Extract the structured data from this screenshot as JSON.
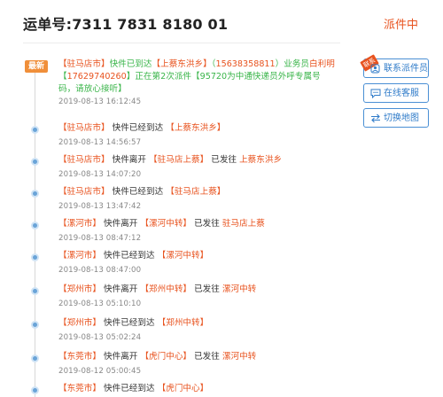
{
  "header": {
    "waybill_label": "运单号:7311 7831 8180 01",
    "status": "派件中"
  },
  "latest_badge": "最新",
  "events": [
    {
      "segments": [
        {
          "text": "【驻马店市】",
          "c": "o"
        },
        {
          "text": "快件已到达",
          "c": "g"
        },
        {
          "text": "【上蔡东洪乡】",
          "c": "o"
        },
        {
          "text": "（",
          "c": "g"
        },
        {
          "text": "15638358811",
          "c": "o"
        },
        {
          "text": "）业务员",
          "c": "g"
        },
        {
          "text": "白利明",
          "c": "o"
        },
        {
          "text": "【",
          "c": "g"
        },
        {
          "text": "17629740260",
          "c": "o"
        },
        {
          "text": "】正在第2次派件【",
          "c": "g"
        },
        {
          "text": "95720为中通快递员外呼专属号码",
          "c": "g"
        },
        {
          "text": "，请放心接听】",
          "c": "g"
        }
      ],
      "time": "2019-08-13 16:12:45"
    },
    {
      "segments": [
        {
          "text": "【驻马店市】",
          "c": "o"
        },
        {
          "text": " 快件已经到达 ",
          "c": "n"
        },
        {
          "text": "【上蔡东洪乡】",
          "c": "o"
        }
      ],
      "time": "2019-08-13 14:56:57"
    },
    {
      "segments": [
        {
          "text": "【驻马店市】",
          "c": "o"
        },
        {
          "text": " 快件离开 ",
          "c": "n"
        },
        {
          "text": "【驻马店上蔡】",
          "c": "o"
        },
        {
          "text": " 已发往 ",
          "c": "n"
        },
        {
          "text": "上蔡东洪乡",
          "c": "o"
        }
      ],
      "time": "2019-08-13 14:07:20"
    },
    {
      "segments": [
        {
          "text": "【驻马店市】",
          "c": "o"
        },
        {
          "text": " 快件已经到达 ",
          "c": "n"
        },
        {
          "text": "【驻马店上蔡】",
          "c": "o"
        }
      ],
      "time": "2019-08-13 13:47:42"
    },
    {
      "segments": [
        {
          "text": "【漯河市】",
          "c": "o"
        },
        {
          "text": " 快件离开 ",
          "c": "n"
        },
        {
          "text": "【漯河中转】",
          "c": "o"
        },
        {
          "text": " 已发往 ",
          "c": "n"
        },
        {
          "text": "驻马店上蔡",
          "c": "o"
        }
      ],
      "time": "2019-08-13 08:47:12"
    },
    {
      "segments": [
        {
          "text": "【漯河市】",
          "c": "o"
        },
        {
          "text": " 快件已经到达 ",
          "c": "n"
        },
        {
          "text": "【漯河中转】",
          "c": "o"
        }
      ],
      "time": "2019-08-13 08:47:00"
    },
    {
      "segments": [
        {
          "text": "【郑州市】",
          "c": "o"
        },
        {
          "text": " 快件离开 ",
          "c": "n"
        },
        {
          "text": "【郑州中转】",
          "c": "o"
        },
        {
          "text": " 已发往 ",
          "c": "n"
        },
        {
          "text": "漯河中转",
          "c": "o"
        }
      ],
      "time": "2019-08-13 05:10:10"
    },
    {
      "segments": [
        {
          "text": "【郑州市】",
          "c": "o"
        },
        {
          "text": " 快件已经到达 ",
          "c": "n"
        },
        {
          "text": "【郑州中转】",
          "c": "o"
        }
      ],
      "time": "2019-08-13 05:02:24"
    },
    {
      "segments": [
        {
          "text": "【东莞市】",
          "c": "o"
        },
        {
          "text": " 快件离开 ",
          "c": "n"
        },
        {
          "text": "【虎门中心】",
          "c": "o"
        },
        {
          "text": " 已发往 ",
          "c": "n"
        },
        {
          "text": "漯河中转",
          "c": "o"
        }
      ],
      "time": "2019-08-12 05:00:45"
    },
    {
      "segments": [
        {
          "text": "【东莞市】",
          "c": "o"
        },
        {
          "text": " 快件已经到达 ",
          "c": "n"
        },
        {
          "text": "【虎门中心】",
          "c": "o"
        }
      ],
      "time": ""
    }
  ],
  "side_buttons": [
    {
      "label": "联系派件员",
      "icon": "phone-contact-icon",
      "ribbon": "联系"
    },
    {
      "label": "在线客服",
      "icon": "chat-icon"
    },
    {
      "label": "切换地图",
      "icon": "switch-arrows-icon"
    }
  ],
  "colors": {
    "accent_orange": "#e8531f",
    "accent_green": "#3ab54a",
    "accent_blue": "#2f7bc9",
    "badge_orange": "#f08f3a"
  }
}
